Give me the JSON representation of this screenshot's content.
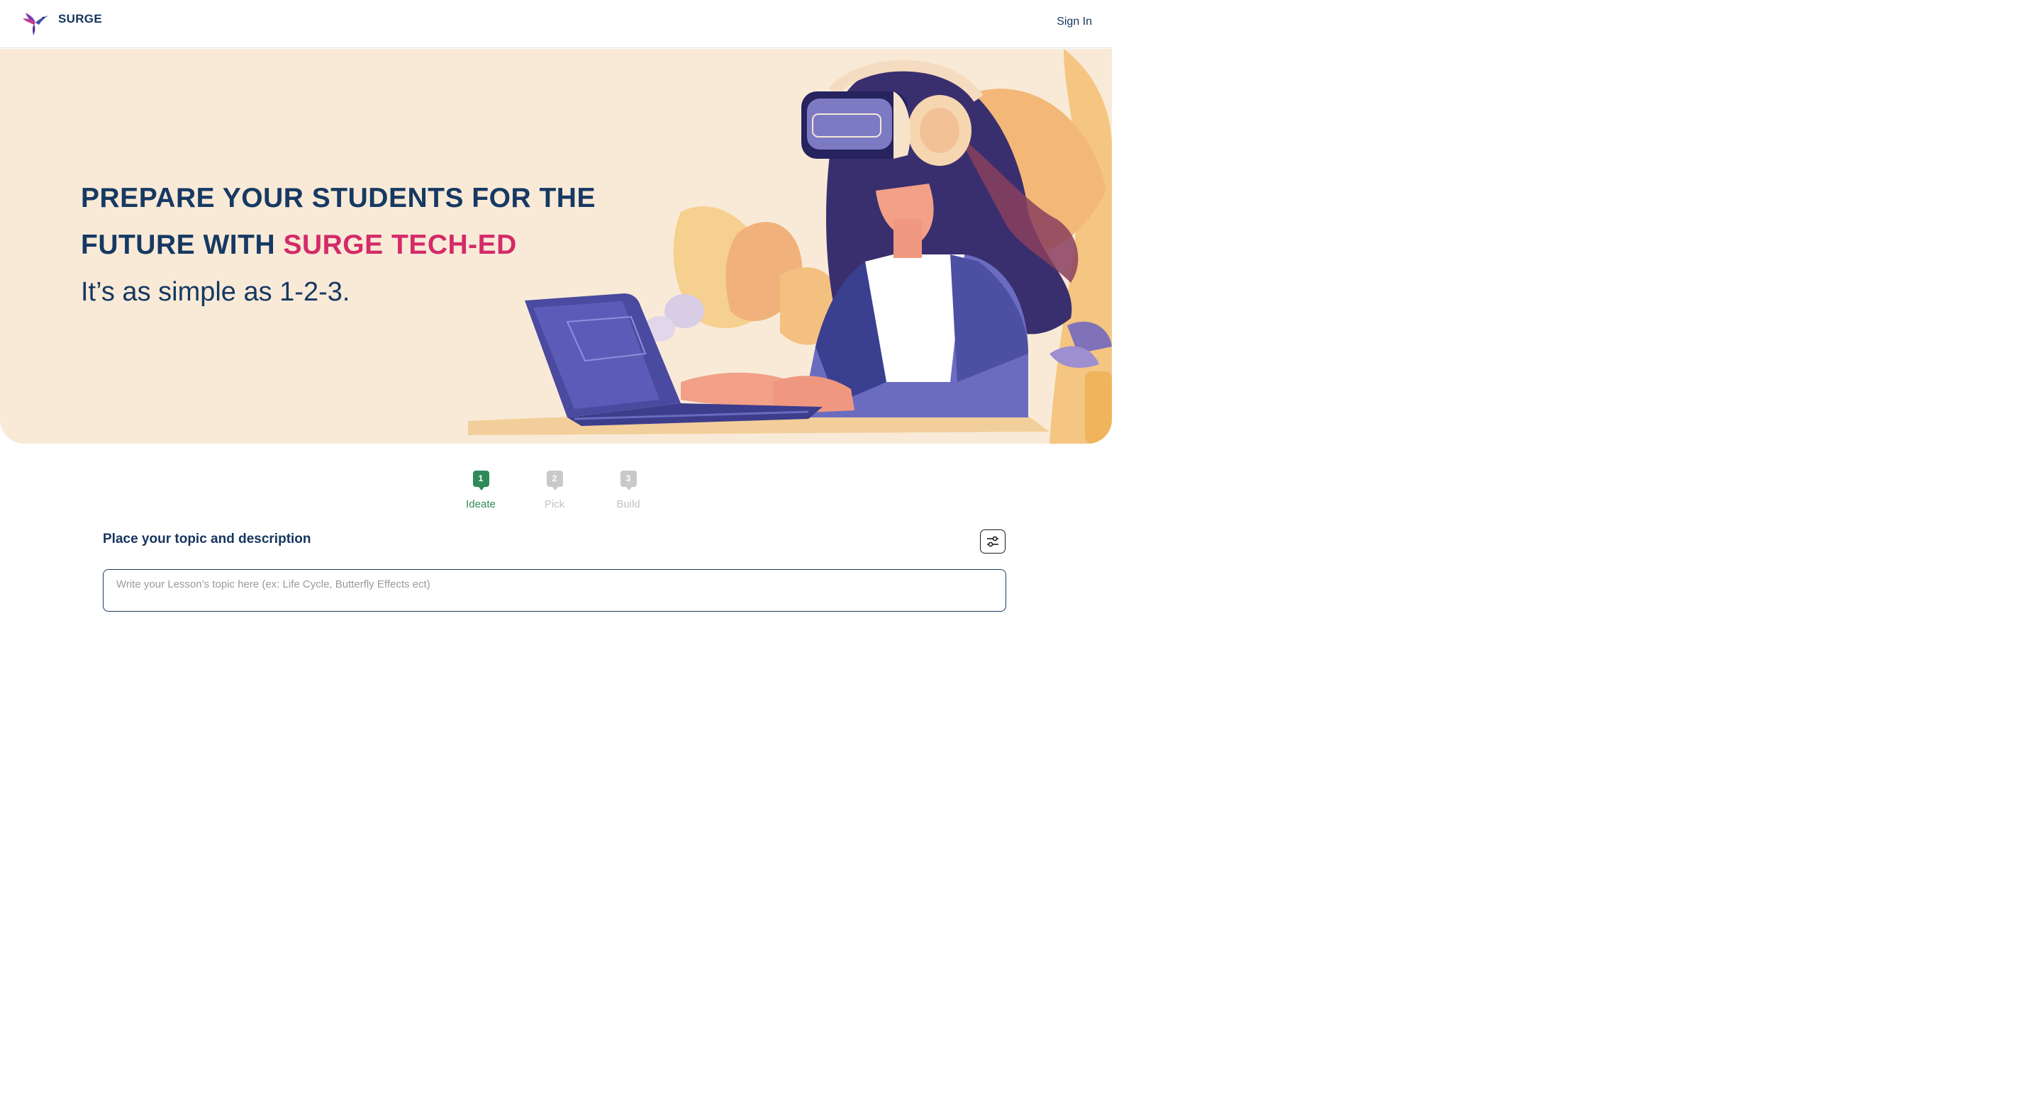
{
  "header": {
    "brand": "SURGE",
    "sign_in": "Sign In"
  },
  "hero": {
    "headline_line1": "PREPARE YOUR STUDENTS FOR THE",
    "headline_line2_prefix": "FUTURE WITH",
    "headline_accent": "SURGE TECH-ED",
    "subline": "It’s as simple as 1-2-3."
  },
  "steps": [
    {
      "number": "1",
      "label": "Ideate",
      "state": "active"
    },
    {
      "number": "2",
      "label": "Pick",
      "state": "inactive"
    },
    {
      "number": "3",
      "label": "Build",
      "state": "inactive"
    }
  ],
  "form": {
    "section_title": "Place your topic and description",
    "topic_placeholder": "Write your Lesson’s topic here (ex: Life Cycle, Butterfly Effects ect)",
    "topic_value": ""
  },
  "icons": {
    "logo": "hummingbird-logo-icon",
    "settings": "sliders-icon"
  },
  "colors": {
    "primary_navy": "#163963",
    "accent_pink": "#d42a68",
    "active_green": "#2f8a5a",
    "hero_background": "#f9ead7"
  }
}
